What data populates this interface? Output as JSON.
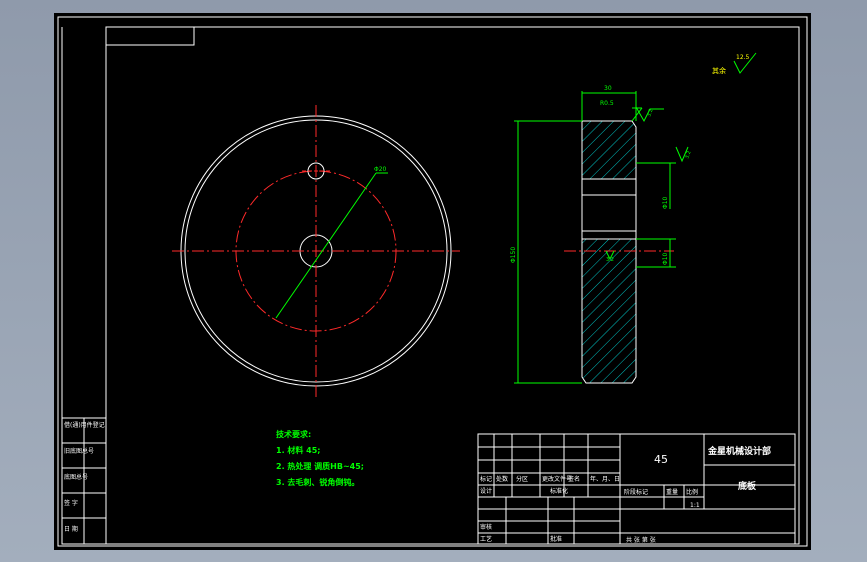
{
  "colors": {
    "background": "#000000",
    "frame": "#ffffff",
    "centerline": "#ff2a2a",
    "dimension": "#00ff00",
    "hatch": "#00c0c0",
    "note_text": "#00ff00",
    "title_text": "#ffffff",
    "roughness_symbol": "#ffff00"
  },
  "drawing": {
    "roughness_symbol_text": "其余",
    "roughness_value": "12.5",
    "dim_diameter_main": "Φ150",
    "dim_thickness": "30",
    "dim_bore": "Φ20",
    "dim_chamfer": "R0.5",
    "dim_hole": "Φ8",
    "dim_side_1": "Φ10",
    "dim_side_2": "Φ10",
    "dim_small_roughness_1": "3.2",
    "dim_small_roughness_2": "3.2",
    "dim_small_roughness_3": "3.2"
  },
  "notes": {
    "heading": "技术要求:",
    "items": [
      "1. 材料 45;",
      "2. 热处理 调质HB~45;",
      "3. 去毛刺、锐角倒钝。"
    ]
  },
  "title_block": {
    "material": "45",
    "company": "金星机械设计部",
    "part_name": "底板",
    "scale": "1:1",
    "mark_label": "标记",
    "count_label": "处数",
    "zone_label": "分区",
    "change_doc_label": "更改文件号",
    "sign_label": "签名",
    "date_label": "年、月、日",
    "design_label": "设计",
    "standard_label": "标准化",
    "review_label": "审核",
    "process_label": "工艺",
    "approve_label": "批准",
    "stage_label": "阶段标记",
    "weight_label": "重量",
    "ratio_label": "比例",
    "sheet_label": "共   张  第   张"
  },
  "side_strip": {
    "items": [
      "借(通)用件登记",
      "旧底图总号",
      "底图总号",
      "签  字",
      "日  期"
    ]
  }
}
